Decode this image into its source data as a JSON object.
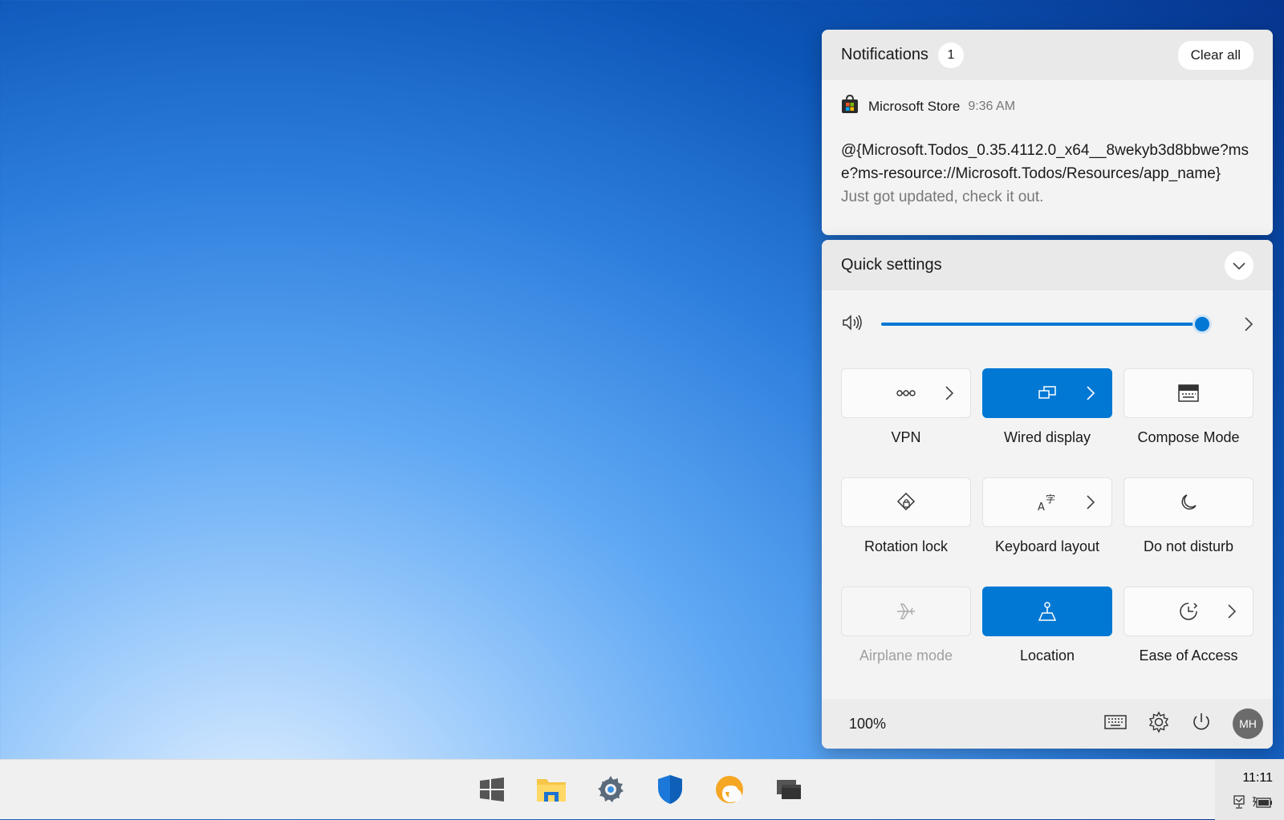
{
  "notifications": {
    "title": "Notifications",
    "count": "1",
    "clear_all": "Clear all",
    "items": [
      {
        "app": "Microsoft Store",
        "time": "9:36 AM",
        "line1": "@{Microsoft.Todos_0.35.4112.0_x64__8wekyb3d8bbwe?ms-resource://Microsoft.Todos/Resources/app_name}",
        "line2": "e?ms-resource://Microsoft.Todos/Resources/app_name}",
        "sub": "Just got updated, check it out.",
        "icon": "microsoft-store-icon"
      }
    ]
  },
  "quick_settings": {
    "title": "Quick settings",
    "volume": {
      "level": 1.0,
      "icon": "speaker-icon"
    },
    "tiles": [
      {
        "label": "VPN",
        "icon": "vpn-icon",
        "on": false,
        "expandable": true,
        "disabled": false
      },
      {
        "label": "Wired display",
        "icon": "wired-display-icon",
        "on": true,
        "expandable": true,
        "disabled": false
      },
      {
        "label": "Compose Mode",
        "icon": "keyboard-icon",
        "on": false,
        "expandable": false,
        "disabled": false
      },
      {
        "label": "Rotation lock",
        "icon": "rotation-lock-icon",
        "on": false,
        "expandable": false,
        "disabled": false
      },
      {
        "label": "Keyboard layout",
        "icon": "keyboard-layout-icon",
        "on": false,
        "expandable": true,
        "disabled": false
      },
      {
        "label": "Do not disturb",
        "icon": "moon-icon",
        "on": false,
        "expandable": false,
        "disabled": false
      },
      {
        "label": "Airplane mode",
        "icon": "airplane-icon",
        "on": false,
        "expandable": false,
        "disabled": true
      },
      {
        "label": "Location",
        "icon": "location-icon",
        "on": true,
        "expandable": false,
        "disabled": false
      },
      {
        "label": "Ease of Access",
        "icon": "ease-of-access-icon",
        "on": false,
        "expandable": true,
        "disabled": false
      }
    ],
    "footer": {
      "battery": "100%",
      "avatar_initials": "MH"
    }
  },
  "taskbar": {
    "apps": [
      "windows-start-icon",
      "file-explorer-icon",
      "settings-icon",
      "windows-security-icon",
      "edge-icon",
      "task-view-icon"
    ],
    "clock": "11:11"
  },
  "colors": {
    "accent": "#0078d4"
  }
}
